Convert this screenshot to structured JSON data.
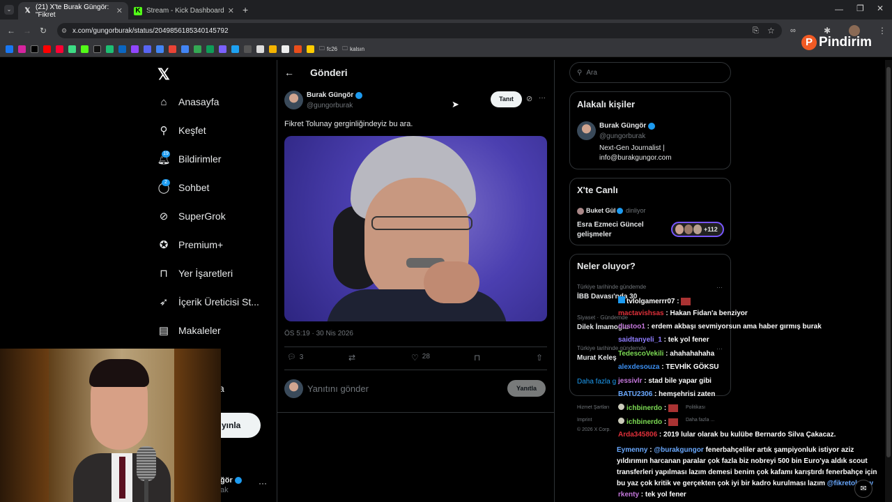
{
  "browser": {
    "tabs": [
      {
        "title": "(21) X'te Burak Güngör: \"Fikret",
        "icon": "x-logo-icon"
      },
      {
        "title": "Stream - Kick Dashboard",
        "icon": "kick-icon"
      }
    ],
    "url": "x.com/gungorburak/status/2049856185340145792",
    "bookmarks": [
      "fc26",
      "kalsın"
    ],
    "overlay_logo": "Pindirim"
  },
  "nav": {
    "items": [
      {
        "label": "Anasayfa",
        "icon": "home-icon"
      },
      {
        "label": "Keşfet",
        "icon": "search-icon"
      },
      {
        "label": "Bildirimler",
        "icon": "bell-icon",
        "badge": "19"
      },
      {
        "label": "Sohbet",
        "icon": "chat-icon",
        "badge": "2"
      },
      {
        "label": "SuperGrok",
        "icon": "grok-icon"
      },
      {
        "label": "Premium+",
        "icon": "premium-icon"
      },
      {
        "label": "Yer İşaretleri",
        "icon": "bookmark-icon"
      },
      {
        "label": "İçerik Üreticisi St...",
        "icon": "rocket-icon"
      },
      {
        "label": "Makaleler",
        "icon": "article-icon"
      }
    ],
    "partial_more": "a",
    "partial_post_button": "yınla",
    "partial_account_name": "ğör",
    "partial_account_handle": "ak"
  },
  "post": {
    "header_title": "Gönderi",
    "author_name": "Burak Güngör",
    "author_handle": "@gungorburak",
    "follow_label": "Tanıt",
    "text": "Fikret Tolunay gerginliğindeyiz bu ara.",
    "timestamp": "ÖS 5:19 · 30 Nis 2026",
    "replies": "3",
    "likes": "28",
    "reply_placeholder": "Yanıtını gönder",
    "reply_button": "Yanıtla"
  },
  "sidebar": {
    "search_placeholder": "Ara",
    "related_title": "Alakalı kişiler",
    "related_name": "Burak Güngör",
    "related_handle": "@gungorburak",
    "related_bio": "Next-Gen Journalist | info@burakgungor.com",
    "live_title": "X'te Canlı",
    "live_host": "Buket Gül",
    "live_status": "dinliyor",
    "live_topic": "Esra Ezmeci Güncel gelişmeler",
    "live_count": "+112",
    "trends_title": "Neler oluyor?",
    "trend1_context": "Türkiye tarihinde gündemde",
    "trend1_name": "İBB Davası'nda 30",
    "trend2_context": "Siyaset · Gündemde",
    "trend2_name": "Dilek İmamoğlu",
    "trend3_context": "Türkiye tarihinde gündemde",
    "trend3_name": "Murat Keleş",
    "show_more": "Daha fazla g",
    "footer1": "Hizmet Şartları",
    "footer2": "Imprint",
    "footer3": "© 2026 X Corp.",
    "footer_partial1": "Politikası",
    "footer_partial2": "Daha fazla ..."
  },
  "chat": [
    {
      "user": "tvlolgamerrr07",
      "color": "#ffffff",
      "msg": ""
    },
    {
      "user": "mactavishsas",
      "color": "#e0303a",
      "msg": "Hakan Fidan'a benziyor"
    },
    {
      "user": "dustoo1",
      "color": "#c678dd",
      "msg": "erdem akbaşı sevmiyorsun ama haber gırmış burak"
    },
    {
      "user": "saidtanyeli_1",
      "color": "#8f7cff",
      "msg": "tek yol fener"
    },
    {
      "user": "TedescoVekili",
      "color": "#7ddc54",
      "msg": "ahahahahaha"
    },
    {
      "user": "alexdesouza",
      "color": "#3b8ef0",
      "msg": "TEVHİK GÖKSU"
    },
    {
      "user": "jessivlr",
      "color": "#c678dd",
      "msg": "stad bile yapar gibi"
    },
    {
      "user": "BATU2306",
      "color": "#6aa9ff",
      "msg": "hemşehrisi zaten"
    },
    {
      "user": "ichbinerdo",
      "color": "#7ddc54",
      "msg": ""
    },
    {
      "user": "ichbinerdo",
      "color": "#7ddc54",
      "msg": ""
    },
    {
      "user": "Arda345806",
      "color": "#e0303a",
      "msg": "2019 lular olarak bu kulübe Bernardo Silva Çakacaz."
    },
    {
      "user": "Eymenny",
      "color": "#6aa9ff",
      "mention": "@burakgungor",
      "msg": "fenerbahçeliler artık şampiyonluk istiyor aziz yıldırımın harcanan paralar çok fazla biz nobreyi 500 bin Euro'ya aldık scout transferleri yapılması lazım demesi benim çok kafamı karıştırdı fenerbahçe için bu yaz çok kritik ve gerçekten çok iyi bir kadro kurulması lazım",
      "mention2": "@fikretolunay"
    },
    {
      "user": "rkenty",
      "color": "#c678dd",
      "msg": "tek yol fener"
    }
  ]
}
